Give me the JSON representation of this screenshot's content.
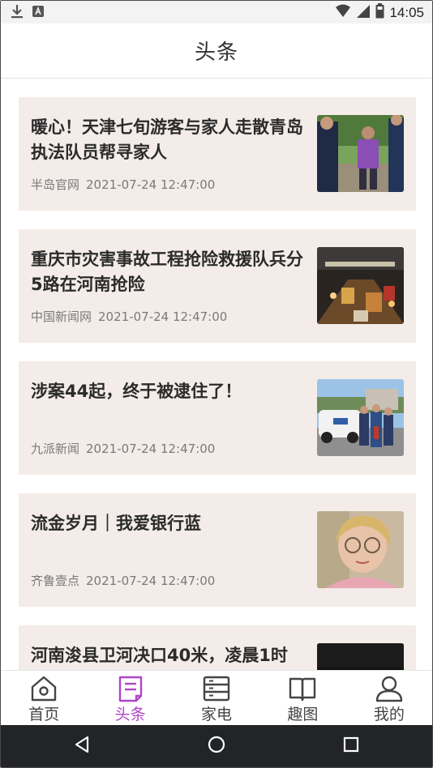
{
  "status_bar": {
    "time": "14:05"
  },
  "header": {
    "title": "头条"
  },
  "feed": [
    {
      "title": "暖心！天津七旬游客与家人走散青岛执法队员帮寻家人",
      "source": "半岛官网",
      "time": "2021-07-24 12:47:00",
      "thumb": "officers-helping-elderly-photo"
    },
    {
      "title": "重庆市灾害事故工程抢险救援队兵分5路在河南抢险",
      "source": "中国新闻网",
      "time": "2021-07-24 12:47:00",
      "thumb": "night-rescue-trucks-photo"
    },
    {
      "title": "涉案44起，终于被逮住了！",
      "source": "九派新闻",
      "time": "2021-07-24 12:47:00",
      "thumb": "police-car-photo"
    },
    {
      "title": "流金岁月｜我爱银行蓝",
      "source": "齐鲁壹点",
      "time": "2021-07-24 12:47:00",
      "thumb": "portrait-photo"
    },
    {
      "title": "河南浚县卫河决口40米，凌晨1时",
      "source": "",
      "time": "",
      "thumb": "dark-night-photo"
    }
  ],
  "bottom_nav": {
    "active": "头条",
    "items": [
      {
        "label": "首页",
        "icon": "home-icon"
      },
      {
        "label": "头条",
        "icon": "news-icon"
      },
      {
        "label": "家电",
        "icon": "appliance-icon"
      },
      {
        "label": "趣图",
        "icon": "book-icon"
      },
      {
        "label": "我的",
        "icon": "user-icon"
      }
    ]
  },
  "colors": {
    "accent": "#b044c9",
    "card_bg": "#f3ece9",
    "text": "#2b2b2b",
    "meta": "#7a7a7a",
    "system_nav": "#222428"
  }
}
